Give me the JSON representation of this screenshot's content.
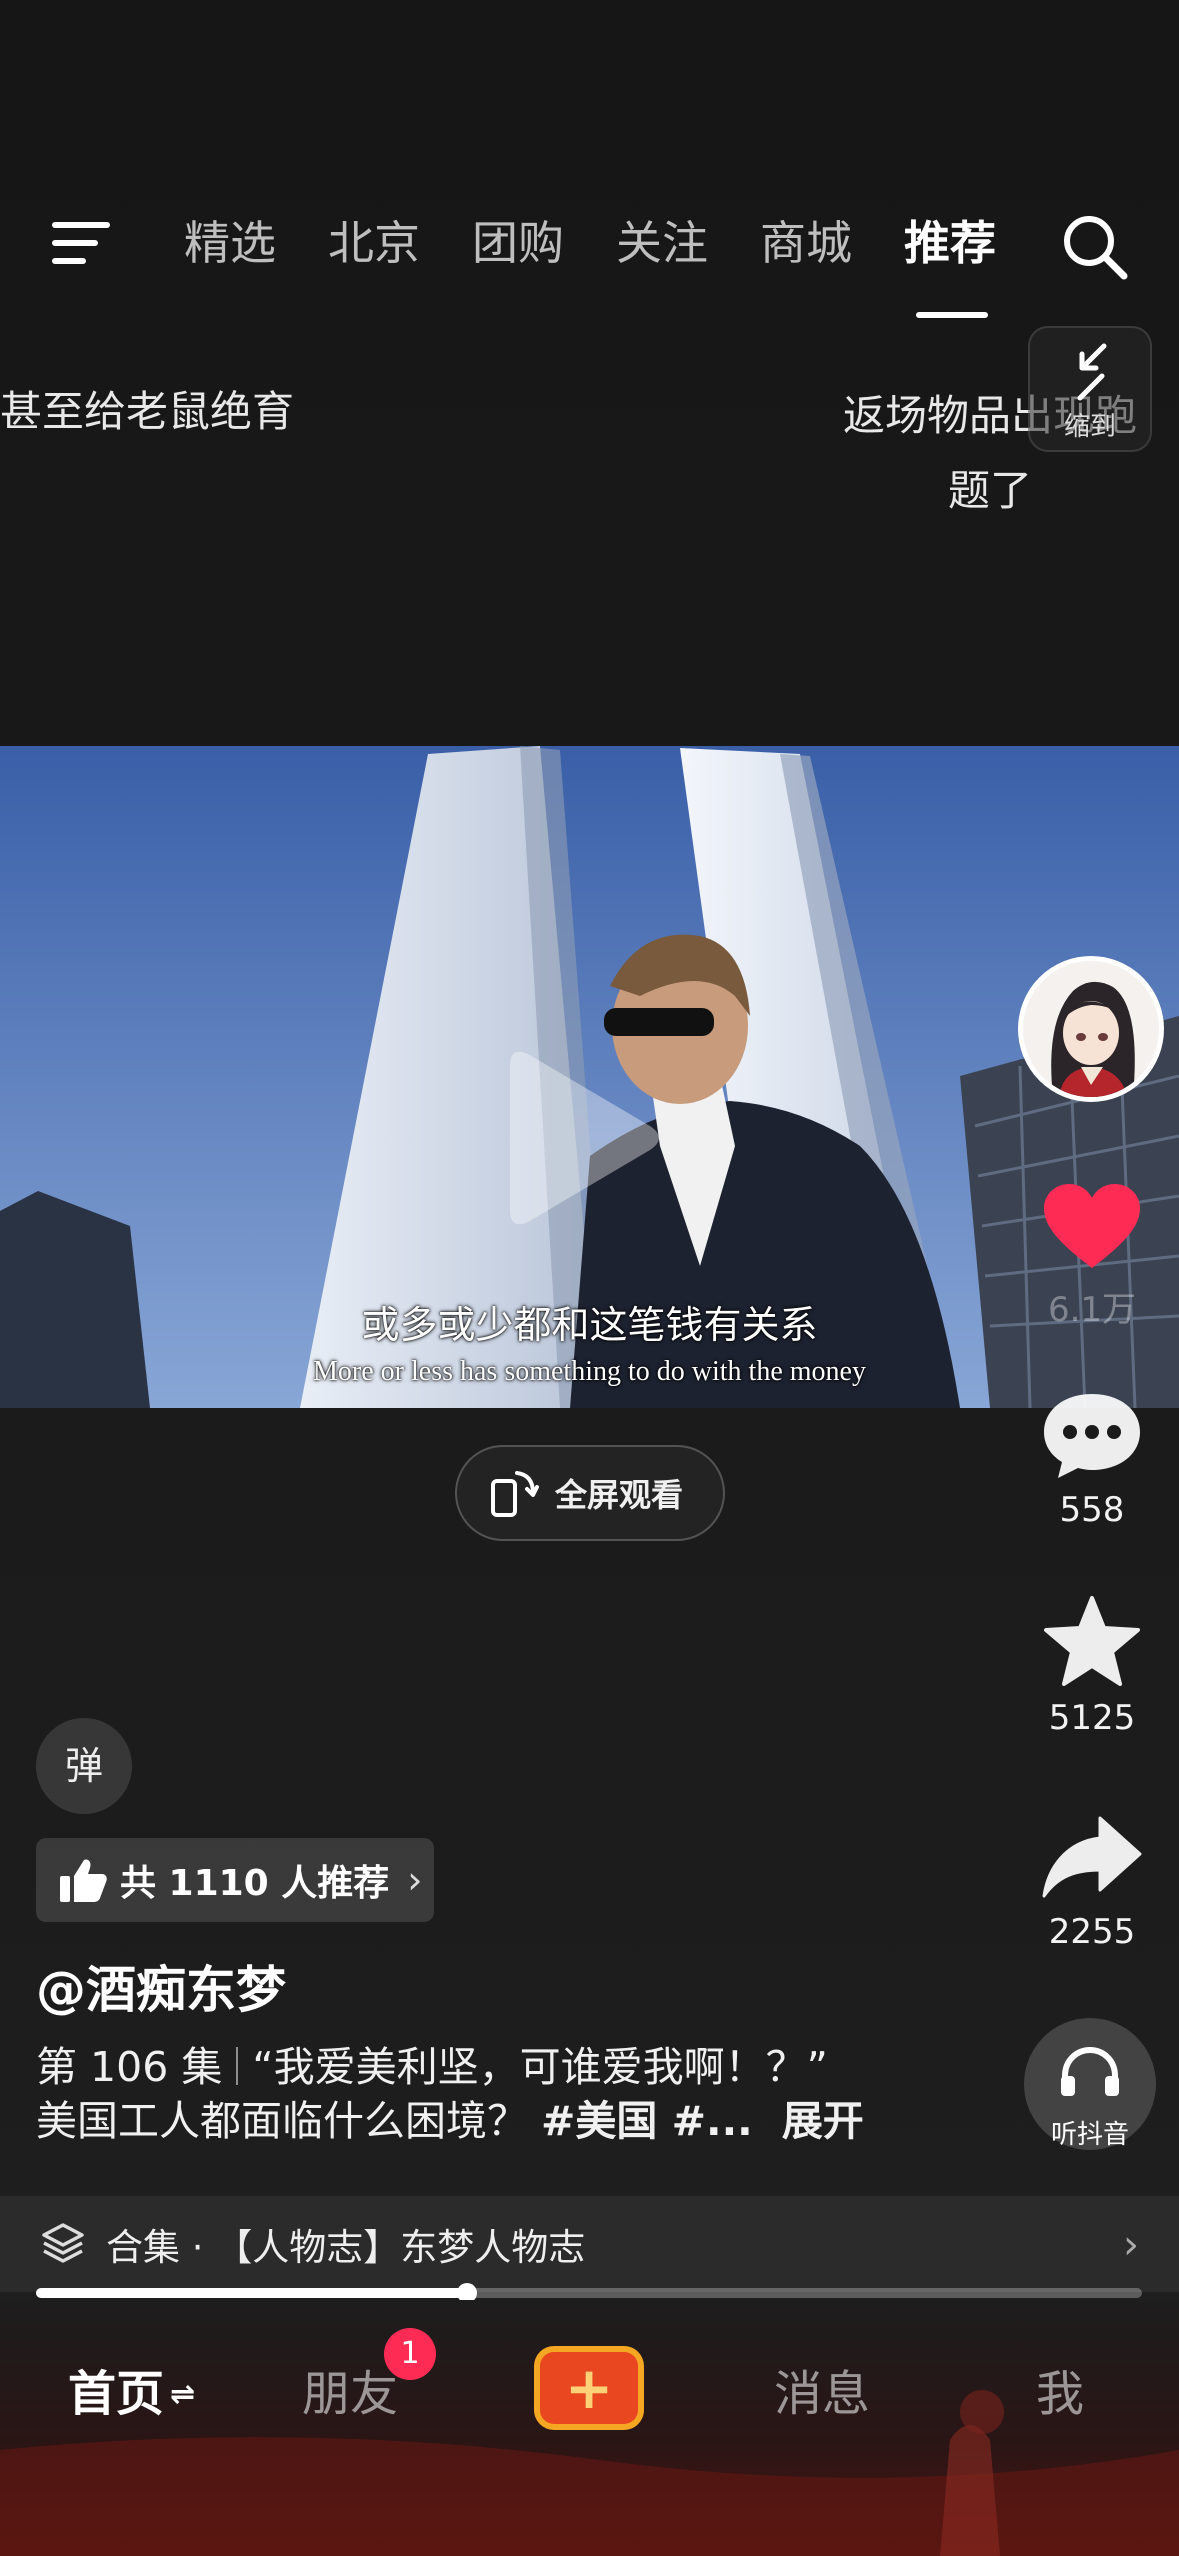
{
  "top_nav": {
    "tabs": [
      "精选",
      "北京",
      "团购",
      "关注",
      "商城",
      "推荐"
    ],
    "active_tab": "推荐"
  },
  "video_titles": {
    "left": "甚至给老鼠绝育",
    "right": "返场物品出现跑题了",
    "shrink_label": "缩到"
  },
  "video": {
    "subtitle_cn": "或多或少都和这笔钱有关系",
    "subtitle_en": "More or less has something to do with the money"
  },
  "fullscreen": {
    "label": "全屏观看"
  },
  "rail": {
    "likes": "6.1万",
    "comments": "558",
    "favorites": "5125",
    "shares": "2255",
    "listen_label": "听抖音"
  },
  "danmu": {
    "label": "弹"
  },
  "recommend": {
    "label": "共 1110 人推荐"
  },
  "post": {
    "author": "@酒痴东梦",
    "episode": "第 106 集",
    "quote": "“我爱美利坚，可谁爱我啊！？”",
    "line2": "美国工人都面临什么困境？",
    "tags": "#美国 #...",
    "expand": "展开"
  },
  "collection": {
    "label": "合集 · 【人物志】东梦人物志"
  },
  "progress": {
    "fraction": 0.39
  },
  "bottom_nav": {
    "home": "首页",
    "friends": "朋友",
    "friends_badge": "1",
    "messages": "消息",
    "me": "我"
  },
  "colors": {
    "like": "#fe2c55",
    "badge": "#fe2c55",
    "add_outer": "#f5a623",
    "add_inner": "#e8471f"
  }
}
